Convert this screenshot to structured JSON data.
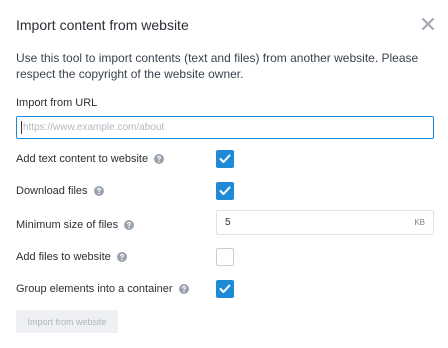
{
  "dialog": {
    "title": "Import content from website",
    "description": "Use this tool to import contents (text and files) from another website. Please respect the copyright of the website owner."
  },
  "url": {
    "label": "Import from URL",
    "placeholder": "https://www.example.com/about",
    "value": ""
  },
  "options": {
    "add_text": {
      "label": "Add text content to website",
      "checked": true
    },
    "download_files": {
      "label": "Download files",
      "checked": true
    },
    "min_size": {
      "label": "Minimum size of files",
      "value": "5",
      "unit": "KB"
    },
    "add_files": {
      "label": "Add files to website",
      "checked": false
    },
    "group_elements": {
      "label": "Group elements into a container",
      "checked": true
    }
  },
  "actions": {
    "import_label": "Import from website"
  },
  "colors": {
    "accent": "#1f8bd6",
    "help_icon": "#9aa3ad",
    "close_icon": "#a0a7b1",
    "disabled_button_bg": "#eef0f3",
    "disabled_button_text": "#b0b6bf"
  },
  "icons": {
    "close": "close-icon",
    "help": "help-icon",
    "check": "checkmark-icon"
  }
}
